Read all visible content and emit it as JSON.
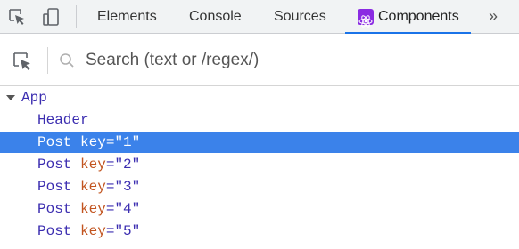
{
  "toolbar": {
    "icons": [
      "inspect-element-icon",
      "device-toolbar-icon"
    ]
  },
  "tabs": [
    {
      "label": "Elements"
    },
    {
      "label": "Console"
    },
    {
      "label": "Sources"
    },
    {
      "label": "Components",
      "active": true,
      "icon": "react-logo-icon"
    }
  ],
  "more_tabs_label": "»",
  "search": {
    "placeholder": "Search (text or /regex/)",
    "value": ""
  },
  "tree": {
    "root": {
      "name": "App",
      "expanded": true
    },
    "children": [
      {
        "name": "Header"
      },
      {
        "name": "Post",
        "key_attr": "key",
        "eq": "=",
        "key_value": "\"1\"",
        "selected": true
      },
      {
        "name": "Post",
        "key_attr": "key",
        "eq": "=",
        "key_value": "\"2\""
      },
      {
        "name": "Post",
        "key_attr": "key",
        "eq": "=",
        "key_value": "\"3\""
      },
      {
        "name": "Post",
        "key_attr": "key",
        "eq": "=",
        "key_value": "\"4\""
      },
      {
        "name": "Post",
        "key_attr": "key",
        "eq": "=",
        "key_value": "\"5\""
      }
    ]
  },
  "colors": {
    "active_tab_underline": "#1a73e8",
    "selection_background": "#3b82ea",
    "component_name": "#3b2db0",
    "prop_key": "#c2541f"
  }
}
